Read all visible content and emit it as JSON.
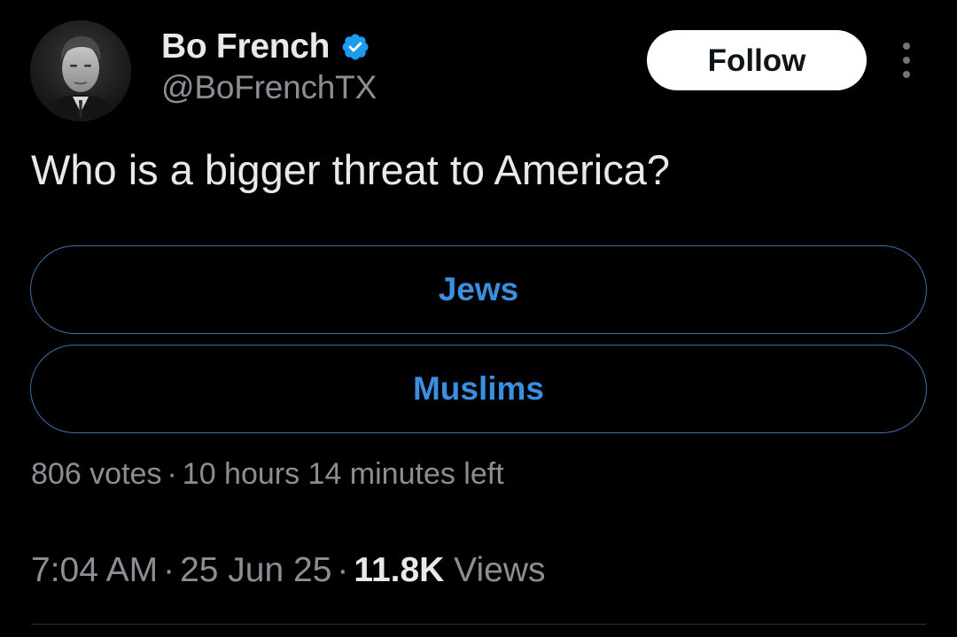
{
  "author": {
    "display_name": "Bo French",
    "handle": "@BoFrenchTX",
    "verified_icon": "verified-badge-icon",
    "verified_color": "#1d9bf0"
  },
  "actions": {
    "follow_label": "Follow",
    "more_icon": "more-dots-icon"
  },
  "tweet": {
    "text": "Who is a bigger threat to America?"
  },
  "poll": {
    "options": [
      {
        "label": "Jews"
      },
      {
        "label": "Muslims"
      }
    ],
    "votes": "806 votes",
    "separator": "·",
    "time_left": "10 hours 14 minutes left",
    "accent_color": "#3a8fe0"
  },
  "meta": {
    "time": "7:04 AM",
    "separator": "·",
    "date": "25 Jun 25",
    "views_count": "11.8K",
    "views_label": "Views"
  }
}
